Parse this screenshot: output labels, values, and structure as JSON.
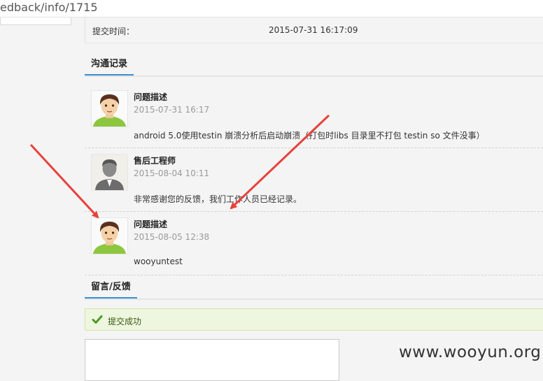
{
  "browser": {
    "url_fragment": "edback/info/1715"
  },
  "submit": {
    "label": "提交时间：",
    "value": "2015-07-31 16:17:09"
  },
  "communication": {
    "title": "沟通记录",
    "entries": [
      {
        "author": "问题描述",
        "time": "2015-07-31 16:17",
        "text": "android 5.0使用testin 崩溃分析后启动崩溃（打包时libs 目录里不打包 testin so 文件没事）",
        "avatar": "user-avatar-icon"
      },
      {
        "author": "售后工程师",
        "time": "2015-08-04 10:11",
        "text": "非常感谢您的反馈，我们工作人员已经记录。",
        "avatar": "default-avatar-icon"
      },
      {
        "author": "问题描述",
        "time": "2015-08-05 12:38",
        "text": "wooyuntest",
        "avatar": "user-avatar-icon"
      }
    ]
  },
  "feedback": {
    "title": "留言/反馈",
    "success_text": "提交成功"
  },
  "watermark": "www.wooyun.org",
  "colors": {
    "accent": "#3b8fd4",
    "success_bg": "#eef6df",
    "check": "#4a9a2a",
    "arrow": "#e8413c"
  }
}
